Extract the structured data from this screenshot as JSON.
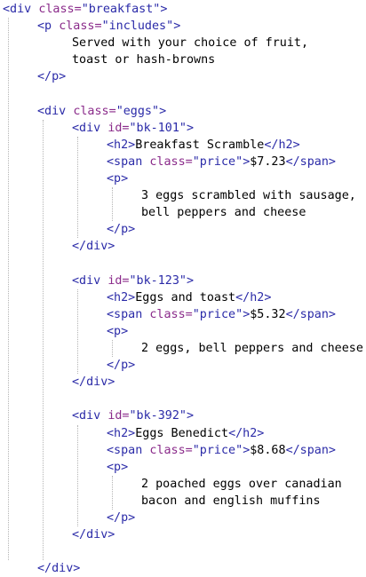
{
  "code_lines": [
    {
      "indent": 0,
      "tokens": [
        {
          "t": "tag",
          "v": "<div"
        },
        {
          "t": "txt",
          "v": " "
        },
        {
          "t": "attr",
          "v": "class="
        },
        {
          "t": "val",
          "v": "\"breakfast\""
        },
        {
          "t": "tag",
          "v": ">"
        }
      ]
    },
    {
      "indent": 1,
      "tokens": [
        {
          "t": "tag",
          "v": "<p"
        },
        {
          "t": "txt",
          "v": " "
        },
        {
          "t": "attr",
          "v": "class="
        },
        {
          "t": "val",
          "v": "\"includes\""
        },
        {
          "t": "tag",
          "v": ">"
        }
      ]
    },
    {
      "indent": 2,
      "tokens": [
        {
          "t": "txt",
          "v": "Served with your choice of fruit,"
        }
      ]
    },
    {
      "indent": 2,
      "tokens": [
        {
          "t": "txt",
          "v": "toast or hash-browns"
        }
      ]
    },
    {
      "indent": 1,
      "tokens": [
        {
          "t": "tag",
          "v": "</p>"
        }
      ]
    },
    {
      "indent": 0,
      "tokens": []
    },
    {
      "indent": 1,
      "tokens": [
        {
          "t": "tag",
          "v": "<div"
        },
        {
          "t": "txt",
          "v": " "
        },
        {
          "t": "attr",
          "v": "class="
        },
        {
          "t": "val",
          "v": "\"eggs\""
        },
        {
          "t": "tag",
          "v": ">"
        }
      ]
    },
    {
      "indent": 2,
      "tokens": [
        {
          "t": "tag",
          "v": "<div"
        },
        {
          "t": "txt",
          "v": " "
        },
        {
          "t": "attr",
          "v": "id="
        },
        {
          "t": "val",
          "v": "\"bk-101\""
        },
        {
          "t": "tag",
          "v": ">"
        }
      ]
    },
    {
      "indent": 3,
      "tokens": [
        {
          "t": "tag",
          "v": "<h2>"
        },
        {
          "t": "txt",
          "v": "Breakfast Scramble"
        },
        {
          "t": "tag",
          "v": "</h2>"
        }
      ]
    },
    {
      "indent": 3,
      "tokens": [
        {
          "t": "tag",
          "v": "<span"
        },
        {
          "t": "txt",
          "v": " "
        },
        {
          "t": "attr",
          "v": "class="
        },
        {
          "t": "val",
          "v": "\"price\""
        },
        {
          "t": "tag",
          "v": ">"
        },
        {
          "t": "txt",
          "v": "$7.23"
        },
        {
          "t": "tag",
          "v": "</span>"
        }
      ]
    },
    {
      "indent": 3,
      "tokens": [
        {
          "t": "tag",
          "v": "<p>"
        }
      ]
    },
    {
      "indent": 4,
      "tokens": [
        {
          "t": "txt",
          "v": "3 eggs scrambled with sausage,"
        }
      ]
    },
    {
      "indent": 4,
      "tokens": [
        {
          "t": "txt",
          "v": "bell peppers and cheese"
        }
      ]
    },
    {
      "indent": 3,
      "tokens": [
        {
          "t": "tag",
          "v": "</p>"
        }
      ]
    },
    {
      "indent": 2,
      "tokens": [
        {
          "t": "tag",
          "v": "</div>"
        }
      ]
    },
    {
      "indent": 0,
      "tokens": []
    },
    {
      "indent": 2,
      "tokens": [
        {
          "t": "tag",
          "v": "<div"
        },
        {
          "t": "txt",
          "v": " "
        },
        {
          "t": "attr",
          "v": "id="
        },
        {
          "t": "val",
          "v": "\"bk-123\""
        },
        {
          "t": "tag",
          "v": ">"
        }
      ]
    },
    {
      "indent": 3,
      "tokens": [
        {
          "t": "tag",
          "v": "<h2>"
        },
        {
          "t": "txt",
          "v": "Eggs and toast"
        },
        {
          "t": "tag",
          "v": "</h2>"
        }
      ]
    },
    {
      "indent": 3,
      "tokens": [
        {
          "t": "tag",
          "v": "<span"
        },
        {
          "t": "txt",
          "v": " "
        },
        {
          "t": "attr",
          "v": "class="
        },
        {
          "t": "val",
          "v": "\"price\""
        },
        {
          "t": "tag",
          "v": ">"
        },
        {
          "t": "txt",
          "v": "$5.32"
        },
        {
          "t": "tag",
          "v": "</span>"
        }
      ]
    },
    {
      "indent": 3,
      "tokens": [
        {
          "t": "tag",
          "v": "<p>"
        }
      ]
    },
    {
      "indent": 4,
      "tokens": [
        {
          "t": "txt",
          "v": "2 eggs, bell peppers and cheese"
        }
      ]
    },
    {
      "indent": 3,
      "tokens": [
        {
          "t": "tag",
          "v": "</p>"
        }
      ]
    },
    {
      "indent": 2,
      "tokens": [
        {
          "t": "tag",
          "v": "</div>"
        }
      ]
    },
    {
      "indent": 0,
      "tokens": []
    },
    {
      "indent": 2,
      "tokens": [
        {
          "t": "tag",
          "v": "<div"
        },
        {
          "t": "txt",
          "v": " "
        },
        {
          "t": "attr",
          "v": "id="
        },
        {
          "t": "val",
          "v": "\"bk-392\""
        },
        {
          "t": "tag",
          "v": ">"
        }
      ]
    },
    {
      "indent": 3,
      "tokens": [
        {
          "t": "tag",
          "v": "<h2>"
        },
        {
          "t": "txt",
          "v": "Eggs Benedict"
        },
        {
          "t": "tag",
          "v": "</h2>"
        }
      ]
    },
    {
      "indent": 3,
      "tokens": [
        {
          "t": "tag",
          "v": "<span"
        },
        {
          "t": "txt",
          "v": " "
        },
        {
          "t": "attr",
          "v": "class="
        },
        {
          "t": "val",
          "v": "\"price\""
        },
        {
          "t": "tag",
          "v": ">"
        },
        {
          "t": "txt",
          "v": "$8.68"
        },
        {
          "t": "tag",
          "v": "</span>"
        }
      ]
    },
    {
      "indent": 3,
      "tokens": [
        {
          "t": "tag",
          "v": "<p>"
        }
      ]
    },
    {
      "indent": 4,
      "tokens": [
        {
          "t": "txt",
          "v": "2 poached eggs over canadian"
        }
      ]
    },
    {
      "indent": 4,
      "tokens": [
        {
          "t": "txt",
          "v": "bacon and english muffins"
        }
      ]
    },
    {
      "indent": 3,
      "tokens": [
        {
          "t": "tag",
          "v": "</p>"
        }
      ]
    },
    {
      "indent": 2,
      "tokens": [
        {
          "t": "tag",
          "v": "</div>"
        }
      ]
    },
    {
      "indent": 0,
      "tokens": []
    },
    {
      "indent": 1,
      "tokens": [
        {
          "t": "tag",
          "v": "</div>"
        }
      ]
    }
  ],
  "colors": {
    "tag": "#2b2ba8",
    "attr": "#8a2a8a",
    "value": "#2a2aa8",
    "text": "#000000",
    "indent_guide": "#b4b4b4",
    "background": "#ffffff"
  }
}
